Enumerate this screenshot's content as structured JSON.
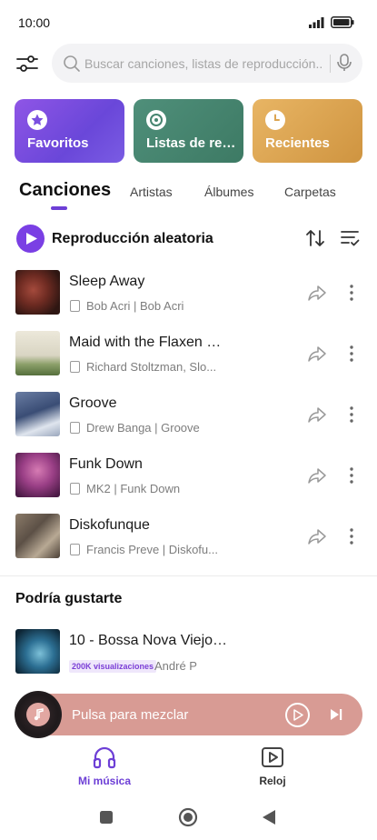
{
  "status_bar": {
    "time": "10:00"
  },
  "search": {
    "placeholder": "Buscar canciones, listas de reproducción..."
  },
  "quick_cards": [
    {
      "label": "Favoritos",
      "icon": "star-icon"
    },
    {
      "label": "Listas de repr...",
      "icon": "playlist-disc-icon"
    },
    {
      "label": "Recientes",
      "icon": "clock-icon"
    }
  ],
  "tabs": [
    {
      "label": "Canciones",
      "active": true
    },
    {
      "label": "Artistas",
      "active": false
    },
    {
      "label": "Álbumes",
      "active": false
    },
    {
      "label": "Carpetas",
      "active": false
    }
  ],
  "shuffle": {
    "label": "Reproducción aleatoria"
  },
  "songs": [
    {
      "title": "Sleep Away",
      "meta": "Bob Acri | Bob Acri"
    },
    {
      "title": "Maid with the Flaxen H...",
      "meta": "Richard Stoltzman, Slo..."
    },
    {
      "title": "Groove",
      "meta": "Drew Banga | Groove"
    },
    {
      "title": "Funk Down",
      "meta": "MK2 | Funk Down"
    },
    {
      "title": "Diskofunque",
      "meta": "Francis Preve | Diskofu..."
    }
  ],
  "suggestions": {
    "title": "Podría gustarte",
    "items": [
      {
        "title": "10 - Bossa Nova Viejo -...",
        "views": "200K visualizaciones",
        "artist": "André P"
      }
    ]
  },
  "mini_player": {
    "label": "Pulsa para mezclar"
  },
  "bottom_nav": [
    {
      "label": "Mi música",
      "active": true,
      "icon": "headphones-icon"
    },
    {
      "label": "Reloj",
      "active": false,
      "icon": "video-play-icon"
    }
  ],
  "colors": {
    "accent": "#6d3fd6",
    "mini_player": "#d89b94",
    "card_favoritos": "#7a4fe0",
    "card_listas": "#468570",
    "card_recientes": "#dca552"
  }
}
